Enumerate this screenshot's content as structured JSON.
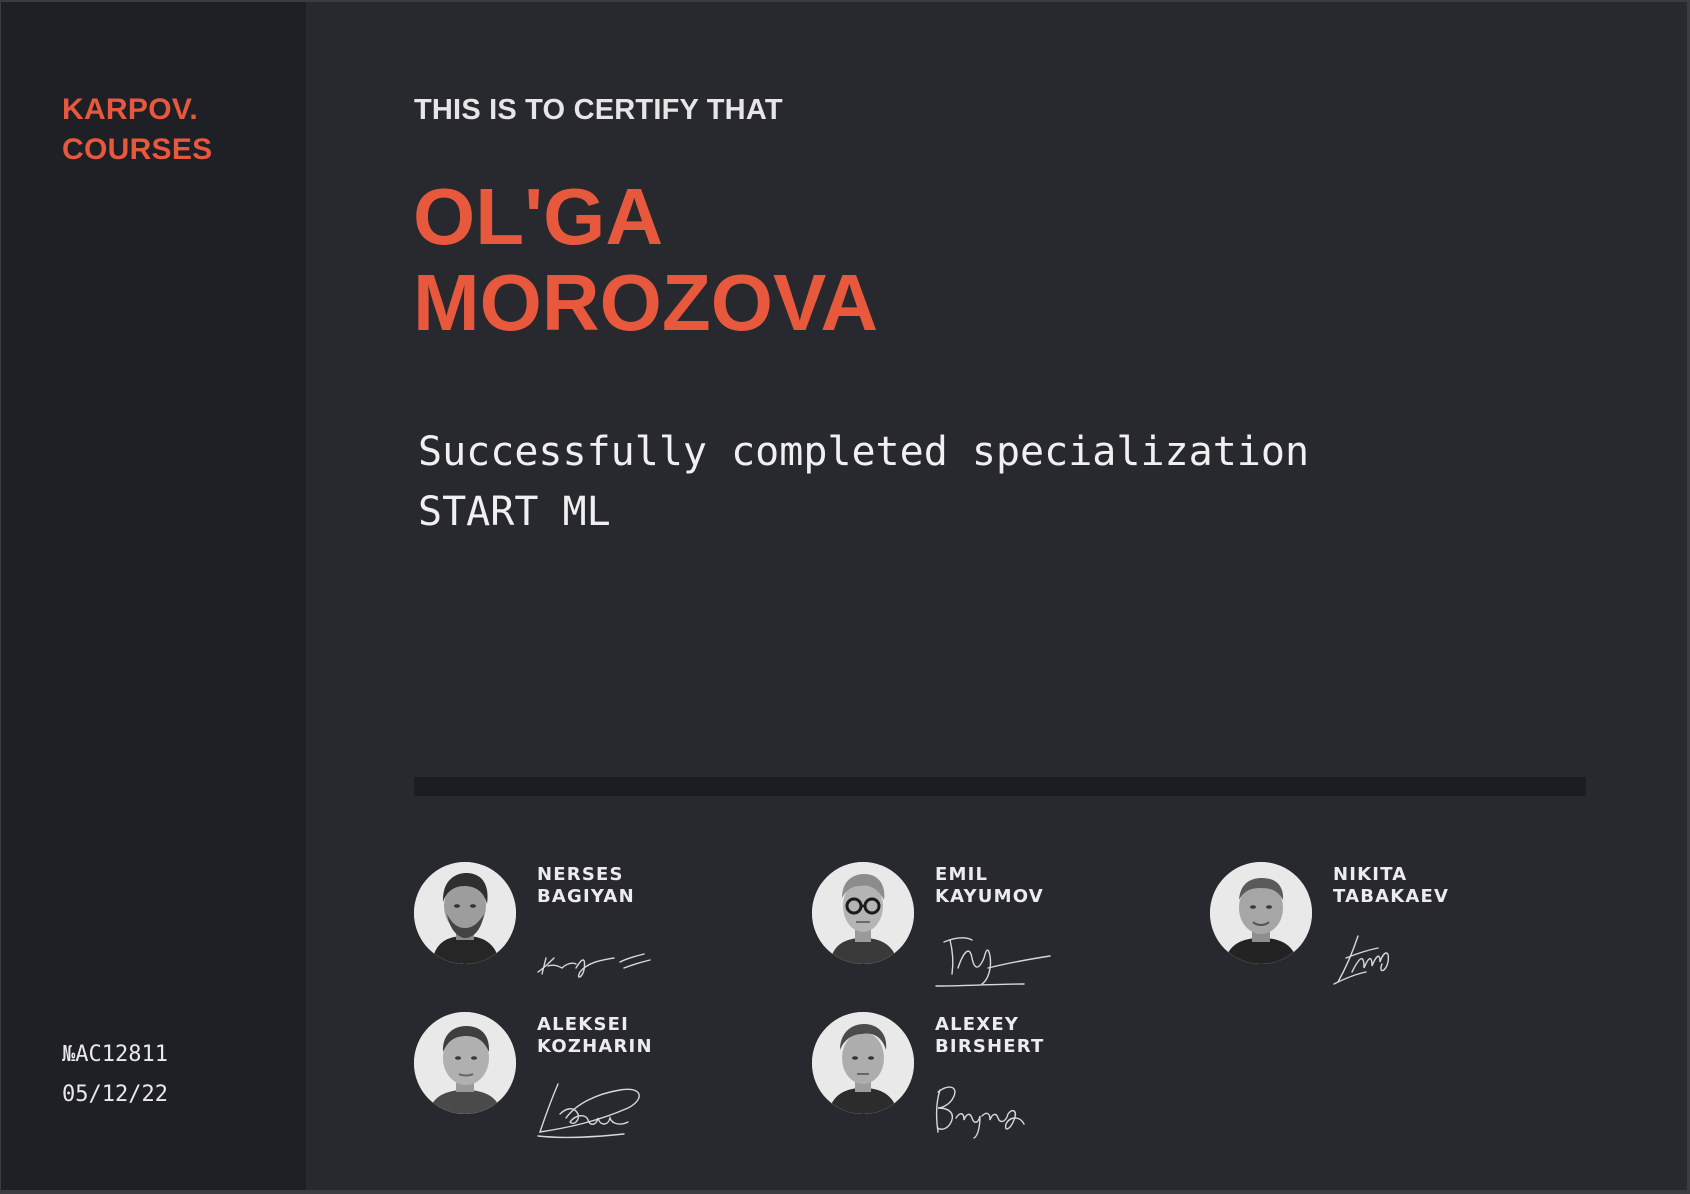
{
  "brand": {
    "line1": "KARPOV.",
    "line2": "COURSES"
  },
  "certificate": {
    "intro": "THIS IS TO CERTIFY THAT",
    "recipient_first": "OL'GA",
    "recipient_last": "MOROZOVA",
    "statement_line1": "Successfully completed specialization",
    "statement_line2": "START ML",
    "number": "№AC12811",
    "date": "05/12/22"
  },
  "colors": {
    "accent": "#e8583d",
    "background": "#27292e",
    "sidebar": "#1f2025",
    "text": "#ececee"
  },
  "signers": [
    {
      "first": "NERSES",
      "last": "BAGIYAN"
    },
    {
      "first": "EMIL",
      "last": "KAYUMOV"
    },
    {
      "first": "NIKITA",
      "last": "TABAKAEV"
    },
    {
      "first": "ALEKSEI",
      "last": "KOZHARIN"
    },
    {
      "first": "ALEXEY",
      "last": "BIRSHERT"
    }
  ]
}
